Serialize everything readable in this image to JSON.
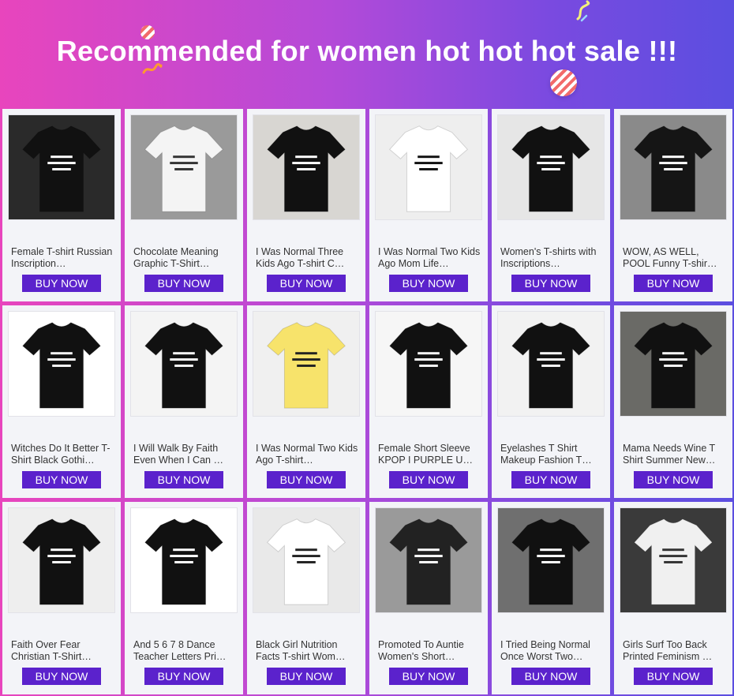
{
  "banner": {
    "title": "Recommended for women hot hot hot sale !!!"
  },
  "buy_label": "BUY NOW",
  "products": [
    {
      "name": "Female T-shirt Russian Inscription…",
      "image": "two-women-black-tees-photo",
      "bg": "#2a2a2a",
      "tee": "#111111",
      "print": "#ffffff"
    },
    {
      "name": "Chocolate Meaning Graphic T-Shirt…",
      "image": "white-tee-chocolate-text-photo",
      "bg": "#9a9a9a",
      "tee": "#f4f4f4",
      "print": "#333333"
    },
    {
      "name": "I Was Normal Three Kids Ago T-shirt C…",
      "image": "black-tee-normal-3-kids-flatlay",
      "bg": "#d8d6d2",
      "tee": "#111111",
      "print": "#ffffff"
    },
    {
      "name": "I Was Normal Two Kids Ago Mom Life…",
      "image": "white-tee-normal-2-kids-flatlay",
      "bg": "#eeeeee",
      "tee": "#ffffff",
      "print": "#111111"
    },
    {
      "name": "Women's T-shirts with Inscriptions…",
      "image": "black-tee-russian-text-flatlay",
      "bg": "#e6e6e6",
      "tee": "#111111",
      "print": "#ffffff"
    },
    {
      "name": "WOW, AS WELL, POOL Funny T-shir…",
      "image": "women-black-white-tees-photo",
      "bg": "#8a8a8a",
      "tee": "#151515",
      "print": "#ffffff"
    },
    {
      "name": "Witches Do It Better T-Shirt Black Gothi…",
      "image": "black-tee-witches-text-photo",
      "bg": "#ffffff",
      "tee": "#111111",
      "print": "#ffffff"
    },
    {
      "name": "I Will Walk By Faith Even When I Can …",
      "image": "black-tee-faith-script-flatlay",
      "bg": "#f4f4f4",
      "tee": "#111111",
      "print": "#ffffff"
    },
    {
      "name": "I Was Normal Two Kids Ago T-shirt…",
      "image": "yellow-tee-normal-kids-flatlay",
      "bg": "#f0f0f0",
      "tee": "#f7e36b",
      "print": "#222222"
    },
    {
      "name": "Female Short Sleeve KPOP I PURPLE U…",
      "image": "black-tee-i-purple-u-flatlay",
      "bg": "#f6f6f6",
      "tee": "#111111",
      "print": "#ffffff"
    },
    {
      "name": "Eyelashes T Shirt Makeup Fashion T…",
      "image": "black-tee-eyelashes-flatlay",
      "bg": "#f2f2f2",
      "tee": "#111111",
      "print": "#ffffff"
    },
    {
      "name": "Mama Needs Wine T Shirt Summer New…",
      "image": "black-tee-mama-wine-photo",
      "bg": "#6a6a66",
      "tee": "#111111",
      "print": "#ffffff"
    },
    {
      "name": "Faith Over Fear Christian T-Shirt…",
      "image": "black-tee-faith-over-fear-flatlay",
      "bg": "#eeeeee",
      "tee": "#111111",
      "print": "#ffffff"
    },
    {
      "name": "And 5 6 7 8 Dance Teacher Letters Pri…",
      "image": "black-tee-and-5678-hanger",
      "bg": "#ffffff",
      "tee": "#111111",
      "print": "#ffffff"
    },
    {
      "name": "Black Girl Nutrition Facts T-shirt Wom…",
      "image": "white-tee-nutrition-facts-photo",
      "bg": "#e9e9e9",
      "tee": "#ffffff",
      "print": "#222222"
    },
    {
      "name": "Promoted To Auntie Women's Short…",
      "image": "black-tee-auntie-photo",
      "bg": "#9a9a9a",
      "tee": "#222222",
      "print": "#ffffff"
    },
    {
      "name": "I Tried Being Normal Once Worst Two…",
      "image": "black-tee-tried-normal-photo",
      "bg": "#6f6f6f",
      "tee": "#111111",
      "print": "#ffffff"
    },
    {
      "name": "Girls Surf Too Back Printed Feminism …",
      "image": "white-tee-girls-surf-too-photo",
      "bg": "#3a3a3a",
      "tee": "#f0f0f0",
      "print": "#333333"
    }
  ]
}
